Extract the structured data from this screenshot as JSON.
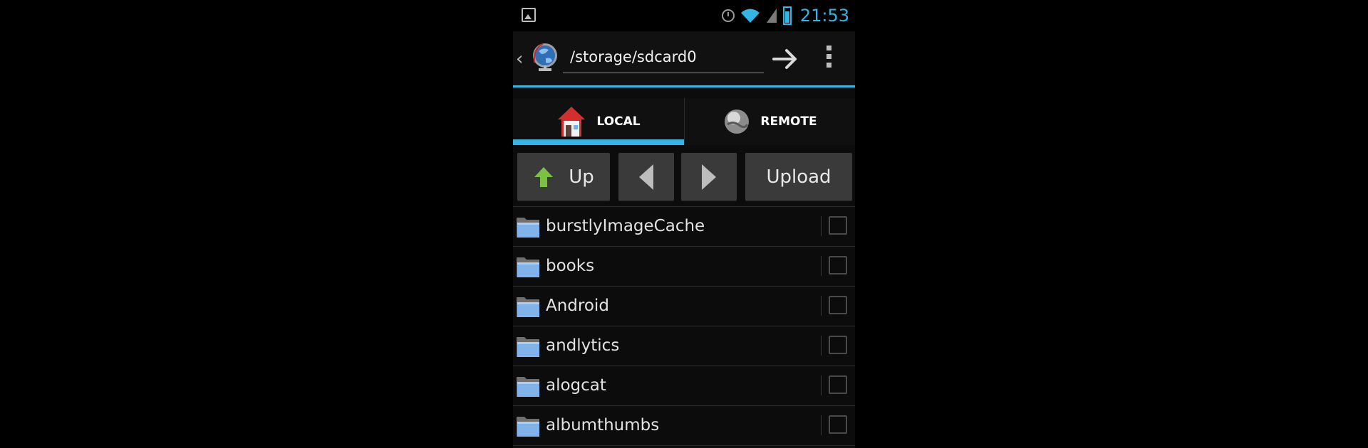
{
  "status_bar": {
    "time": "21:53",
    "icons": [
      "gallery-icon",
      "alarm-icon",
      "wifi-icon",
      "signal-icon",
      "battery-icon"
    ],
    "accent_color": "#33b5e5"
  },
  "action_bar": {
    "path": "/storage/sdcard0",
    "icons": [
      "back-chevron-icon",
      "globe-logo-icon",
      "go-arrow-icon",
      "overflow-menu-icon"
    ]
  },
  "tabs": [
    {
      "label": "LOCAL",
      "icon": "home-icon",
      "selected": true
    },
    {
      "label": "REMOTE",
      "icon": "globe-icon",
      "selected": false
    }
  ],
  "toolbar": {
    "up_label": "Up",
    "upload_label": "Upload",
    "prev_icon": "triangle-left-icon",
    "next_icon": "triangle-right-icon"
  },
  "files": [
    {
      "name": "burstlyImageCache",
      "checked": false
    },
    {
      "name": "books",
      "checked": false
    },
    {
      "name": "Android",
      "checked": false
    },
    {
      "name": "andlytics",
      "checked": false
    },
    {
      "name": "alogcat",
      "checked": false
    },
    {
      "name": "albumthumbs",
      "checked": false
    }
  ]
}
